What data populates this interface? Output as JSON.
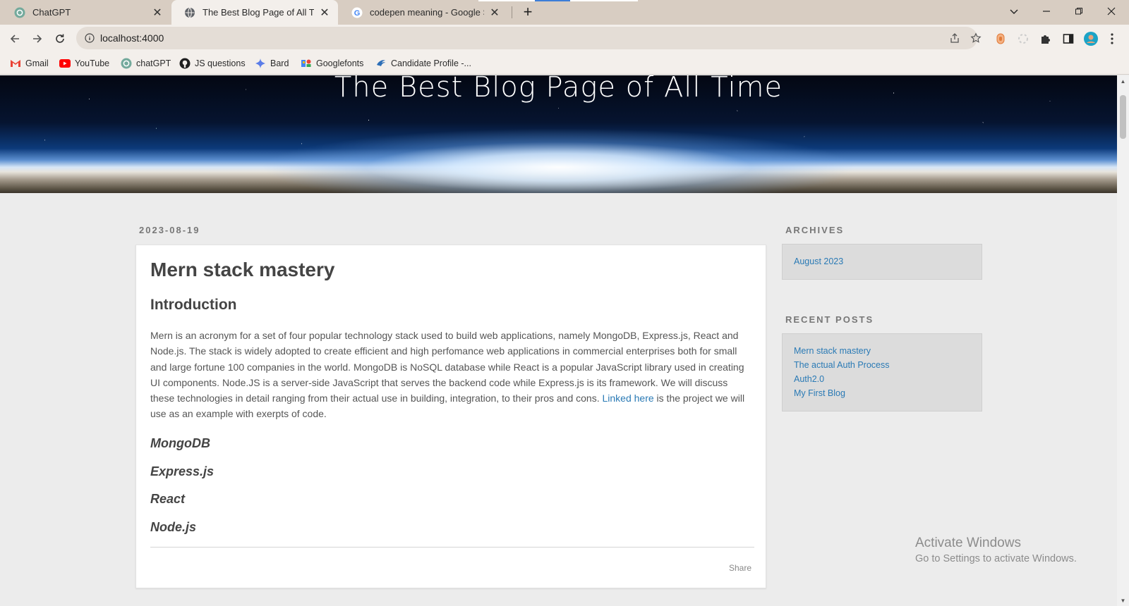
{
  "browser": {
    "tabs": [
      {
        "label": "ChatGPT",
        "icon": "chatgpt-icon",
        "active": false
      },
      {
        "label": "The Best Blog Page of All Time",
        "icon": "globe-icon",
        "active": true
      },
      {
        "label": "codepen meaning - Google Search",
        "icon": "google-icon",
        "active": false
      }
    ],
    "url": "localhost:4000",
    "bookmarks": [
      {
        "label": "Gmail",
        "icon": "gmail-icon"
      },
      {
        "label": "YouTube",
        "icon": "youtube-icon"
      },
      {
        "label": "chatGPT",
        "icon": "chatgpt-icon"
      },
      {
        "label": "JS questions",
        "icon": "github-icon"
      },
      {
        "label": "Bard",
        "icon": "bard-icon"
      },
      {
        "label": "Googlefonts",
        "icon": "googlefonts-icon"
      },
      {
        "label": "Candidate Profile -...",
        "icon": "candidate-icon"
      }
    ]
  },
  "page": {
    "site_title": "The Best Blog Page of All Time",
    "post": {
      "date": "2023-08-19",
      "title": "Mern stack mastery",
      "section_heading": "Introduction",
      "body_before_link": "Mern is an acronym for a set of four popular technology stack used to build web applications, namely MongoDB, Express.js, React and Node.js. The stack is widely adopted to create efficient and high perfomance web applications in commercial enterprises both for small and large fortune 100 companies in the world. MongoDB is NoSQL database while React is a popular JavaScript library used in creating UI components. Node.JS is a server-side JavaScript that serves the backend code while Express.js is its framework. We will discuss these technologies in detail ranging from their actual use in building, integration, to their pros and cons. ",
      "link_text": "Linked here",
      "body_after_link": " is the project we will use as an example with exerpts of code.",
      "subheadings": [
        "MongoDB",
        "Express.js",
        "React",
        "Node.js"
      ],
      "share_label": "Share"
    },
    "sidebar": {
      "archives_title": "ARCHIVES",
      "archives": [
        "August 2023"
      ],
      "recent_title": "RECENT POSTS",
      "recent_posts": [
        "Mern stack mastery",
        "The actual Auth Process",
        "Auth2.0",
        "My First Blog"
      ]
    }
  },
  "os_overlay": {
    "line1": "Activate Windows",
    "line2": "Go to Settings to activate Windows."
  },
  "colors": {
    "link": "#2a7ab5",
    "chrome_frame": "#d8cdc2",
    "chrome_toolbar": "#f3efeb",
    "page_background": "#ececec"
  }
}
